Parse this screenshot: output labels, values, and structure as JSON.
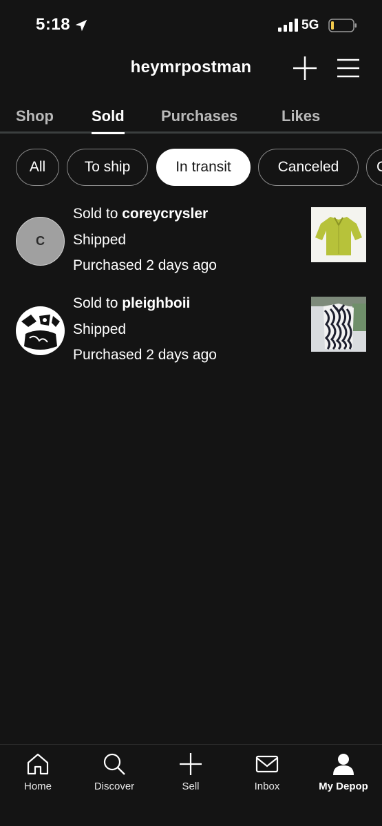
{
  "status_bar": {
    "time": "5:18",
    "network": "5G",
    "icons": [
      "location-arrow-icon",
      "signal-icon",
      "battery-icon"
    ]
  },
  "header": {
    "username": "heymrpostman",
    "icons": [
      "plus-icon",
      "menu-icon"
    ]
  },
  "tabs": [
    {
      "label": "Shop",
      "active": false
    },
    {
      "label": "Sold",
      "active": true
    },
    {
      "label": "Purchases",
      "active": false
    },
    {
      "label": "Likes",
      "active": false
    }
  ],
  "filters": [
    {
      "label": "All",
      "active": false
    },
    {
      "label": "To ship",
      "active": false
    },
    {
      "label": "In transit",
      "active": true
    },
    {
      "label": "Canceled",
      "active": false
    },
    {
      "label": "C",
      "active": false
    }
  ],
  "orders": [
    {
      "sold_prefix": "Sold to",
      "buyer": "coreycrysler",
      "avatar_initial": "C",
      "status": "Shipped",
      "purchased": "Purchased 2 days ago"
    },
    {
      "sold_prefix": "Sold to",
      "buyer": "pleighboii",
      "status": "Shipped",
      "purchased": "Purchased 2 days ago"
    }
  ],
  "bottom_nav": [
    {
      "label": "Home",
      "icon": "home-icon",
      "active": false
    },
    {
      "label": "Discover",
      "icon": "search-icon",
      "active": false
    },
    {
      "label": "Sell",
      "icon": "plus-icon",
      "active": false
    },
    {
      "label": "Inbox",
      "icon": "mail-icon",
      "active": false
    },
    {
      "label": "My Depop",
      "icon": "person-icon",
      "active": true
    }
  ],
  "colors": {
    "background": "#141414",
    "text": "#ffffff",
    "tab_inactive": "#b9b9b9",
    "chip_border": "#8a8a8a",
    "battery_low": "#f2c94c",
    "garment_yellow": "#b7c23a"
  }
}
